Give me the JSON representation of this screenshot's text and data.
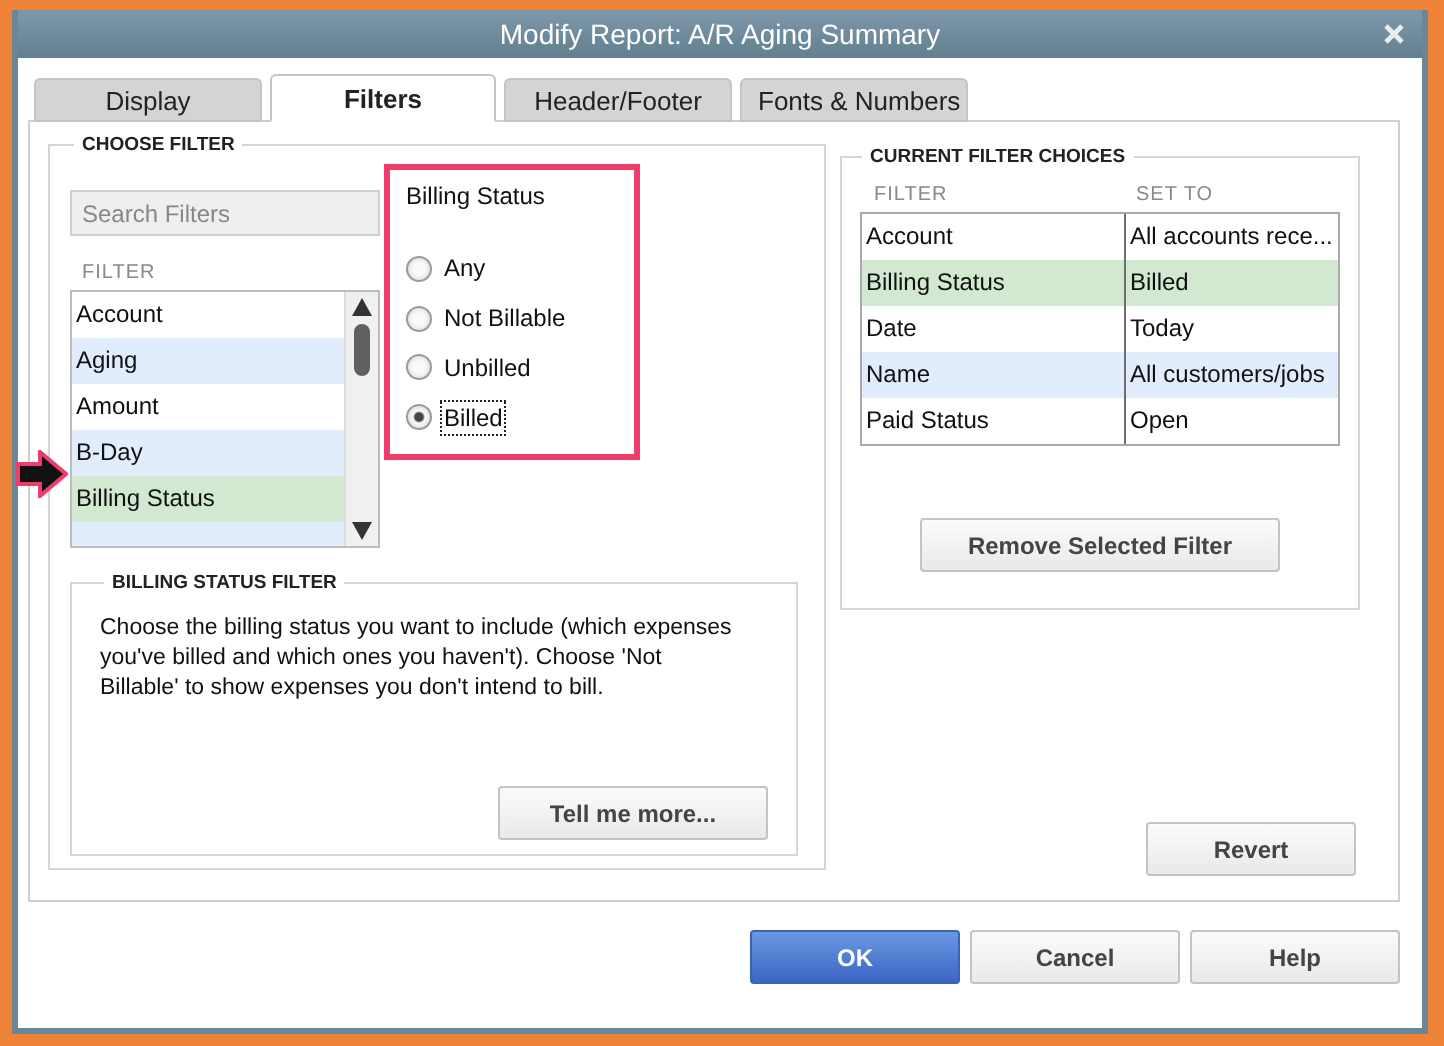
{
  "window": {
    "title": "Modify Report: A/R Aging Summary"
  },
  "tabs": [
    {
      "label": "Display",
      "selected": false
    },
    {
      "label": "Filters",
      "selected": true
    },
    {
      "label": "Header/Footer",
      "selected": false
    },
    {
      "label": "Fonts & Numbers",
      "selected": false
    }
  ],
  "choose_filter": {
    "heading": "CHOOSE FILTER",
    "search": {
      "placeholder": "Search Filters"
    },
    "list_heading": "FILTER",
    "items": [
      {
        "label": "Account",
        "selected": false
      },
      {
        "label": "Aging",
        "selected": false
      },
      {
        "label": "Amount",
        "selected": false
      },
      {
        "label": "B-Day",
        "selected": false
      },
      {
        "label": "Billing Status",
        "selected": true
      }
    ],
    "option_group": {
      "title": "Billing Status",
      "options": [
        {
          "label": "Any",
          "selected": false
        },
        {
          "label": "Not Billable",
          "selected": false
        },
        {
          "label": "Unbilled",
          "selected": false
        },
        {
          "label": "Billed",
          "selected": true
        }
      ]
    },
    "description": {
      "heading": "BILLING STATUS FILTER",
      "text": "Choose the billing status you want to include (which expenses you've billed and which ones you haven't). Choose 'Not Billable' to show expenses you don't intend to bill.",
      "button": "Tell me more..."
    }
  },
  "current_filters": {
    "heading": "CURRENT FILTER CHOICES",
    "columns": [
      "FILTER",
      "SET TO"
    ],
    "rows": [
      {
        "filter": "Account",
        "set_to": "All accounts rece...",
        "selected": false
      },
      {
        "filter": "Billing Status",
        "set_to": "Billed",
        "selected": true
      },
      {
        "filter": "Date",
        "set_to": "Today",
        "selected": false
      },
      {
        "filter": "Name",
        "set_to": "All customers/jobs",
        "selected": false
      },
      {
        "filter": "Paid Status",
        "set_to": "Open",
        "selected": false
      }
    ],
    "remove_button": "Remove Selected Filter"
  },
  "revert_button": "Revert",
  "buttons": [
    {
      "label": "OK",
      "kind": "primary"
    },
    {
      "label": "Cancel",
      "kind": "default"
    },
    {
      "label": "Help",
      "kind": "default"
    }
  ]
}
